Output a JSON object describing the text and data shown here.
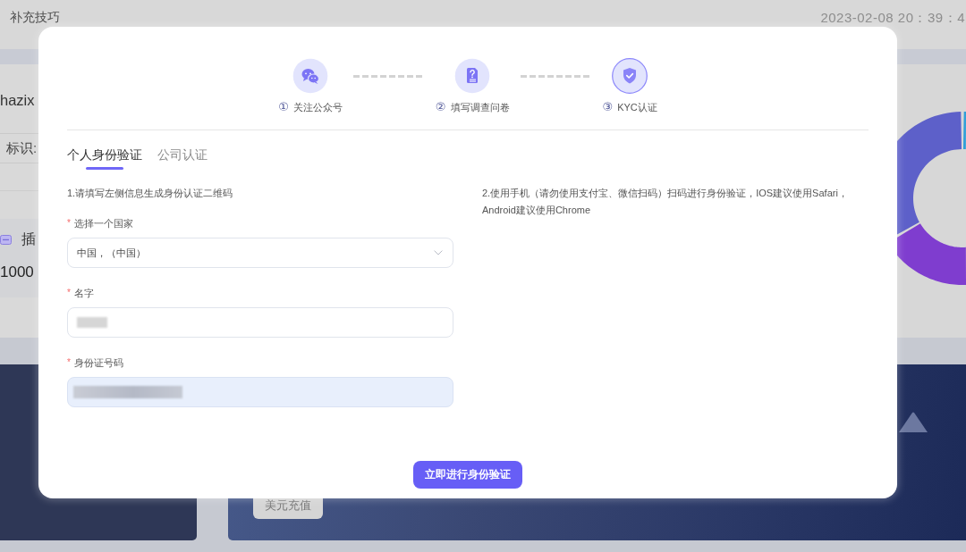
{
  "page": {
    "header": {
      "title": "补充技巧",
      "datetime": "2023-02-08 20：39：4"
    },
    "account_card": {
      "username": "hazix",
      "id_label": "标识:",
      "plugin_title": "插",
      "amount": "1000"
    },
    "recharge_card": {
      "button": "美元充值"
    }
  },
  "dialog": {
    "steps": [
      {
        "number": "①",
        "label": "关注公众号",
        "active": false
      },
      {
        "number": "②",
        "label": "填写调查问卷",
        "active": false
      },
      {
        "number": "③",
        "label": "KYC认证",
        "active": true
      }
    ],
    "tabs": [
      {
        "label": "个人身份验证",
        "selected": true
      },
      {
        "label": "公司认证",
        "selected": false
      }
    ],
    "left_instruction": "1.请填写左侧信息生成身份认证二维码",
    "fields": [
      {
        "kind": "select",
        "required_mark": "*",
        "label": "选择一个国家",
        "value": "中国，（中国）",
        "redacted": false,
        "autofilled": false
      },
      {
        "kind": "text",
        "required_mark": "*",
        "label": "名字",
        "redacted": true,
        "autofilled": false
      },
      {
        "kind": "text",
        "required_mark": "*",
        "label": "身份证号码",
        "redacted": true,
        "autofilled": true
      }
    ],
    "right_instruction": "2.使用手机（请勿使用支付宝、微信扫码）扫码进行身份验证，IOS建议使用Safari，Android建议使用Chrome",
    "submit_button": "立即进行身份验证"
  }
}
